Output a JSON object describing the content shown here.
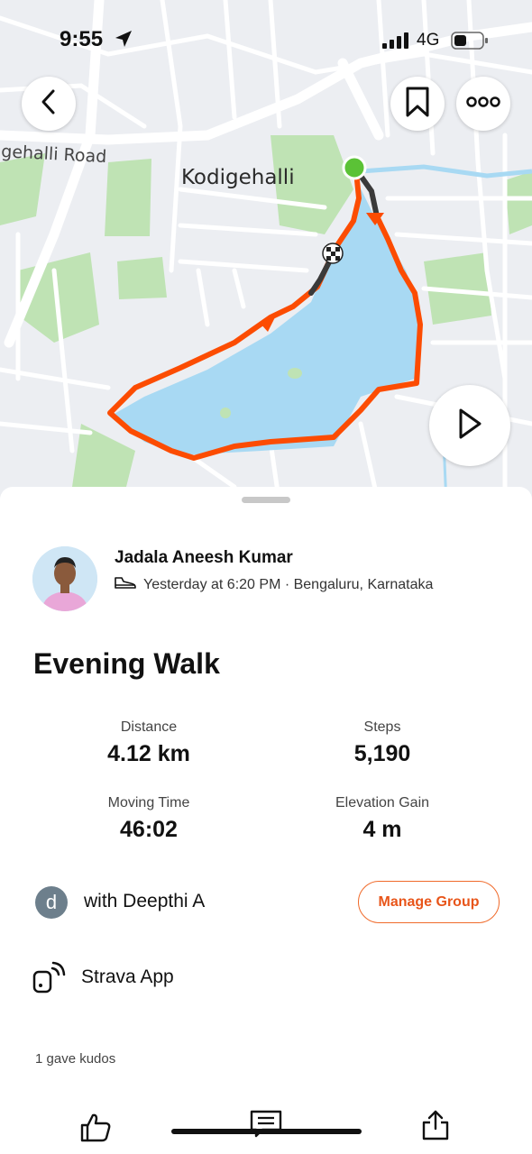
{
  "status_bar": {
    "time": "9:55",
    "network": "4G",
    "icons": [
      "location-arrow-icon",
      "signal-bars-icon",
      "battery-icon"
    ]
  },
  "map": {
    "road_label": "igehalli Road",
    "area_label": "Kodigehalli",
    "buttons": {
      "back": "chevron-left-icon",
      "save": "bookmark-icon",
      "more": "more-dots-icon",
      "play": "play-icon"
    },
    "colors": {
      "route": "#fc4c02",
      "route_dark": "#3a3a3a",
      "water": "#a8d9f3",
      "park": "#bfe3b4",
      "start": "#5bc236"
    }
  },
  "activity": {
    "athlete_name": "Jadala Aneesh Kumar",
    "sport_icon": "shoe-icon",
    "meta": "Yesterday at 6:20 PM · Bengaluru, Karnataka",
    "title": "Evening Walk",
    "stats": [
      {
        "label": "Distance",
        "value": "4.12 km"
      },
      {
        "label": "Steps",
        "value": "5,190"
      },
      {
        "label": "Moving Time",
        "value": "46:02"
      },
      {
        "label": "Elevation Gain",
        "value": "4 m"
      }
    ],
    "group": {
      "initial": "d",
      "text": "with Deepthi A",
      "button": "Manage Group"
    },
    "device": "Strava App",
    "kudos": "1 gave kudos"
  },
  "bottom_actions": [
    "thumbs-up-icon",
    "comment-icon",
    "share-icon"
  ]
}
